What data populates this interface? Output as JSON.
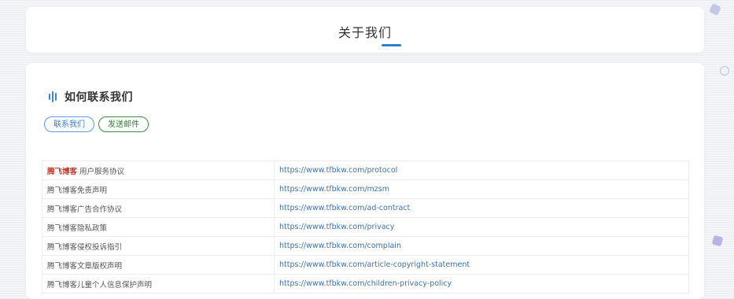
{
  "header": {
    "title": "关于我们"
  },
  "section": {
    "title": "如何联系我们"
  },
  "buttons": {
    "contact_label": "联系我们",
    "mail_label": "发送邮件"
  },
  "links": {
    "brand": "腾飞博客",
    "rows": [
      {
        "name": "用户服务协议",
        "url": "https://www.tfbkw.com/protocol"
      },
      {
        "name": "腾飞博客免责声明",
        "url": "https://www.tfbkw.com/mzsm"
      },
      {
        "name": "腾飞博客广告合作协议",
        "url": "https://www.tfbkw.com/ad-contract"
      },
      {
        "name": "腾飞博客隐私政策",
        "url": "https://www.tfbkw.com/privacy"
      },
      {
        "name": "腾飞博客侵权投诉指引",
        "url": "https://www.tfbkw.com/complain"
      },
      {
        "name": "腾飞博客文章版权声明",
        "url": "https://www.tfbkw.com/article-copyright-statement"
      },
      {
        "name": "腾飞博客儿童个人信息保护声明",
        "url": "https://www.tfbkw.com/children-privacy-policy"
      }
    ]
  },
  "icons": {
    "section_icon": "audio-bars-icon"
  },
  "colors": {
    "accent_blue": "#2f7fd0",
    "link_blue": "#3a72b8",
    "brand_red": "#c0392b",
    "mail_green": "#2e7d32"
  }
}
